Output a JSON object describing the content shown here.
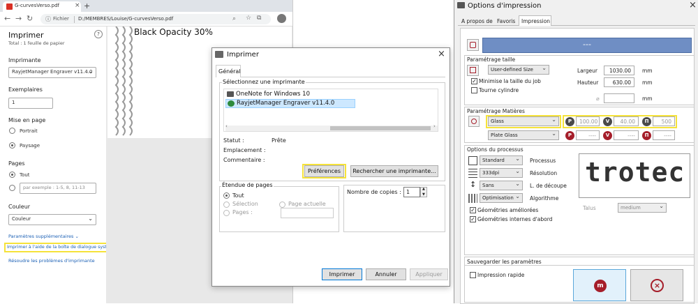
{
  "browser": {
    "tab_title": "G-curvesVerso.pdf",
    "tab_close": "×",
    "new_tab": "+",
    "address_label": "Fichier",
    "address_url": "D:/MEMBRES/Louise/G-curvesVerso.pdf"
  },
  "print_panel": {
    "title": "Imprimer",
    "subtitle": "Total : 1 feuille de papier",
    "help": "?",
    "printer_label": "Imprimante",
    "printer_value": "RayjetManager Engraver v11.4.0",
    "copies_label": "Exemplaires",
    "copies_value": "1",
    "layout_label": "Mise en page",
    "layout_portrait": "Portrait",
    "layout_landscape": "Paysage",
    "pages_label": "Pages",
    "pages_all": "Tout",
    "pages_placeholder": "par exemple : 1-5, 8, 11-13",
    "color_label": "Couleur",
    "color_value": "Couleur",
    "more_settings": "Paramètres supplémentaires",
    "system_dialog_link": "Imprimer à l'aide de la boîte de dialogue système (C",
    "troubleshoot_link": "Résoudre les problèmes d'imprimante"
  },
  "preview": {
    "title": "Black Opacity 30%"
  },
  "system_dialog": {
    "title": "Imprimer",
    "close": "×",
    "tab_general": "Général",
    "select_printer_label": "Sélectionnez une imprimante",
    "printers": [
      "OneNote for Windows 10",
      "RayjetManager Engraver v11.4.0"
    ],
    "status_label": "Statut :",
    "status_value": "Prête",
    "location_label": "Emplacement :",
    "comment_label": "Commentaire :",
    "preferences_button": "Préférences",
    "find_printer_button": "Rechercher une imprimante...",
    "page_range_label": "Étendue de pages",
    "range_all": "Tout",
    "range_selection": "Sélection",
    "range_current": "Page actuelle",
    "range_pages": "Pages :",
    "copies_label": "Nombre de copies :",
    "copies_value": "1",
    "print_button": "Imprimer",
    "cancel_button": "Annuler",
    "apply_button": "Appliquer"
  },
  "options": {
    "title": "Options d'impression",
    "close": "×",
    "tabs": [
      "A propos de",
      "Favoris",
      "Impression"
    ],
    "banner_text": "---",
    "size_section": "Paramétrage taille",
    "size_dropdown": "User-defined Size",
    "minimize_label": "Minimise la taille du job",
    "rotate_label": "Tourne cylindre",
    "width_label": "Largeur",
    "width_value": "1030.00",
    "width_unit": "mm",
    "height_label": "Hauteur",
    "height_value": "630.00",
    "height_unit": "mm",
    "diameter_symbol": "⌀",
    "diameter_unit": "mm",
    "material_section": "Paramétrage Matières",
    "material_1": "Glass",
    "material_2": "Plate Glass",
    "p_badge": "P",
    "v_badge": "V",
    "ppi_badge": "Π",
    "power_1": "100.00",
    "speed_1": "40.00",
    "ppi_1": "500",
    "power_2": "----",
    "speed_2": "----",
    "ppi_2": "----",
    "process_section": "Options du processus",
    "process_dropdown": "Standard",
    "process_label": "Processus",
    "resolution_dropdown": "333dpi",
    "resolution_label": "Résolution",
    "cutline_dropdown": "Sans",
    "cutline_label": "L. de découpe",
    "algorithm_dropdown": "Optimisation",
    "algorithm_label": "Algorithme",
    "improved_geom_label": "Géométries améliorées",
    "internal_geom_label": "Géométries internes d'abord",
    "logo_text": "trotec",
    "talus_label": "Talus",
    "talus_value": "medium",
    "save_section": "Sauvegarder les paramètres",
    "quick_print_label": "Impression rapide",
    "check_mark": "✓",
    "accent_blue": "#6f8ec4",
    "highlight_yellow": "#f5e23a",
    "trotec_red": "#a51e2a"
  }
}
